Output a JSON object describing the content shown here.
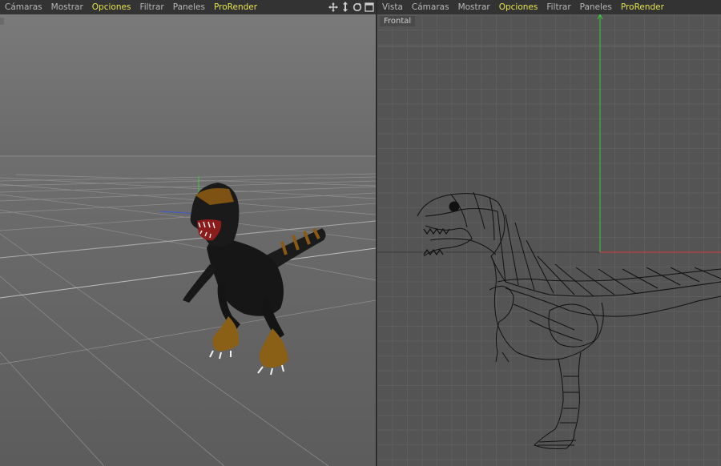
{
  "left_viewport": {
    "menu": [
      {
        "label": "Cámaras",
        "active": false
      },
      {
        "label": "Mostrar",
        "active": false
      },
      {
        "label": "Opciones",
        "active": true
      },
      {
        "label": "Filtrar",
        "active": false
      },
      {
        "label": "Paneles",
        "active": false
      },
      {
        "label": "ProRender",
        "active": true
      }
    ],
    "nav_icons": [
      "move-icon",
      "zoom-icon",
      "rotate-icon",
      "maximize-icon"
    ],
    "projection": "perspective"
  },
  "right_viewport": {
    "menu": [
      {
        "label": "Vista",
        "active": false
      },
      {
        "label": "Cámaras",
        "active": false
      },
      {
        "label": "Mostrar",
        "active": false
      },
      {
        "label": "Opciones",
        "active": true
      },
      {
        "label": "Filtrar",
        "active": false
      },
      {
        "label": "Paneles",
        "active": false
      },
      {
        "label": "ProRender",
        "active": true
      }
    ],
    "view_label": "Frontal",
    "projection": "front-wireframe"
  },
  "colors": {
    "menu_active": "#e6e34e",
    "axis_x": "#d23c3c",
    "axis_y": "#3cc83c",
    "axis_z": "#3c5ad2"
  }
}
